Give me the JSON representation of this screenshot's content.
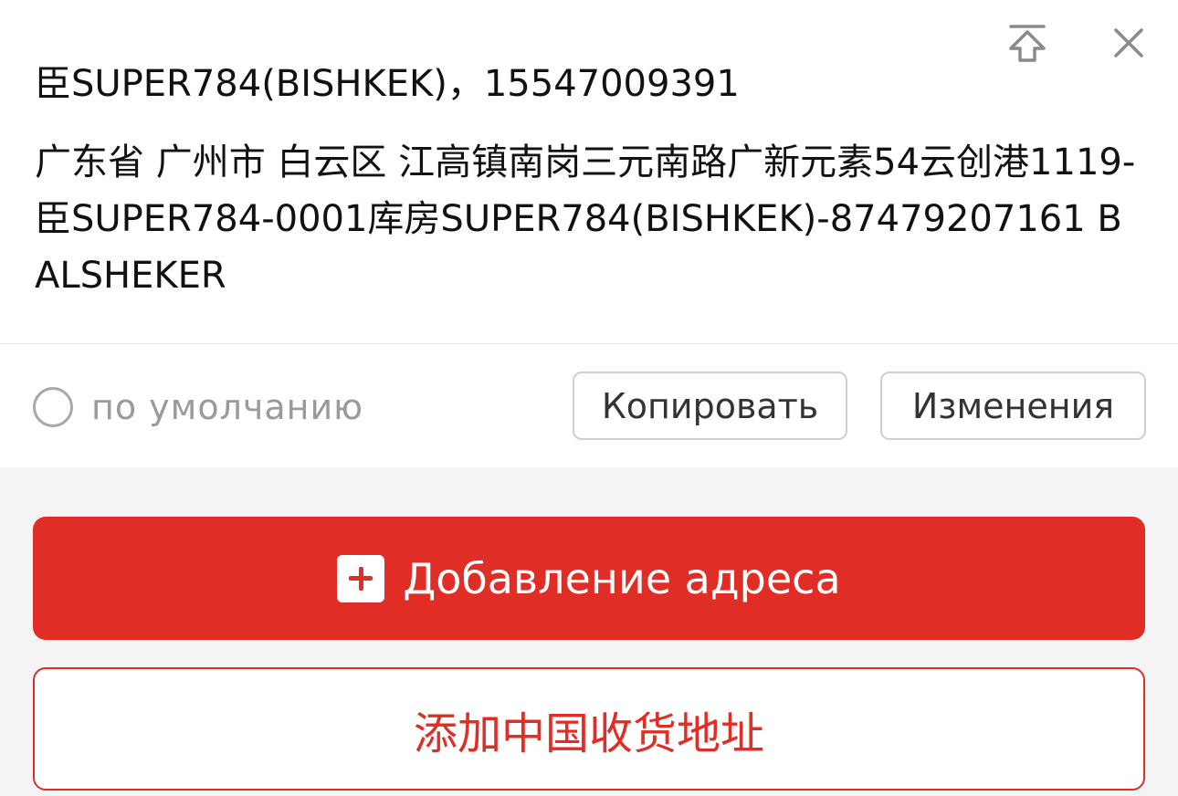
{
  "address_card": {
    "recipient_line": "臣SUPER784(BISHKEK)，15547009391",
    "address": "广东省 广州市 白云区 江高镇南岗三元南路广新元素54云创港1119-臣SUPER784-0001库房SUPER784(BISHKEK)-87479207161 BALSHEKER",
    "top_icon": "pin-to-top-icon",
    "close_icon": "close-icon",
    "default_label": "по умолчанию",
    "copy_label": "Копировать",
    "edit_label": "Изменения"
  },
  "actions": {
    "add_address_label": "Добавление адреса",
    "add_address_icon": "plus-square-icon",
    "add_china_address_label": "添加中国收货地址"
  },
  "colors": {
    "accent": "#e02d26",
    "text": "#111111",
    "muted": "#9a9a9a"
  }
}
